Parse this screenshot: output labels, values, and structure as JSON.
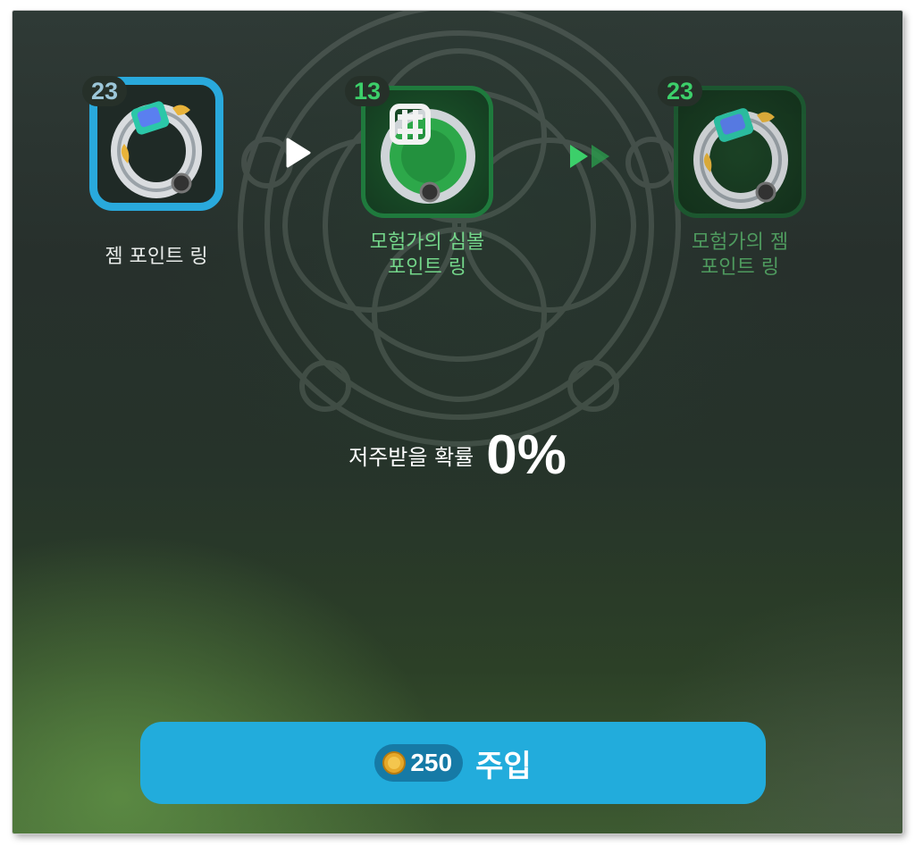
{
  "items": {
    "current": {
      "name": "젬 포인트 링",
      "level": "23"
    },
    "material": {
      "name_line1": "모험가의 심볼",
      "name_line2": "포인트 링",
      "level": "13"
    },
    "result": {
      "name_line1": "모험가의 젬",
      "name_line2": "포인트 링",
      "level": "23"
    }
  },
  "curse_chance": {
    "label": "저주받을 확률",
    "value": "0%"
  },
  "inject_button": {
    "cost": "250",
    "label": "주입"
  },
  "colors": {
    "selected_border": "#29a9dc",
    "accent_green": "#3ccf6a",
    "button": "#22acdc"
  },
  "icons": [
    "gem-ring-icon",
    "symbol-ring-icon",
    "gold-coin-icon",
    "arrow-right-icon",
    "double-arrow-icon"
  ]
}
